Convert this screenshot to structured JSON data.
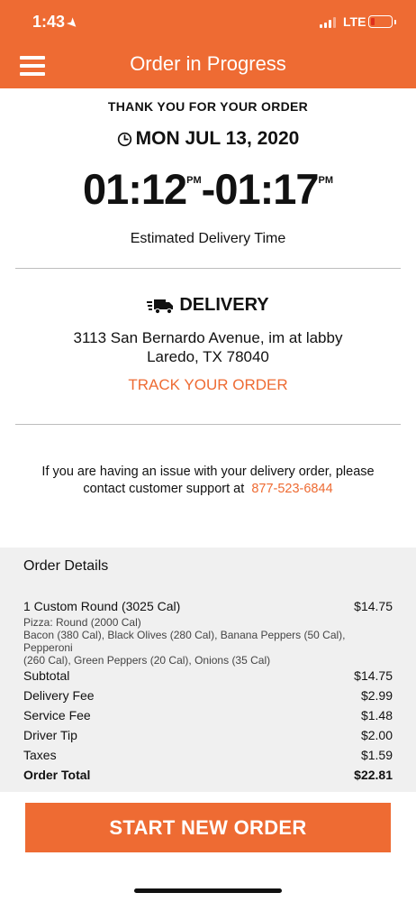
{
  "status_bar": {
    "time": "1:43",
    "network": "LTE"
  },
  "header": {
    "title": "Order in Progress",
    "menu_icon": "menu-icon"
  },
  "confirmation": {
    "thank_you": "THANK YOU FOR YOUR ORDER",
    "date": "MON JUL 13, 2020",
    "time_start": "01:12",
    "time_start_suffix": "PM",
    "time_sep": "-",
    "time_end": "01:17",
    "time_end_suffix": "PM",
    "estimate_label": "Estimated Delivery Time"
  },
  "delivery": {
    "label": "DELIVERY",
    "address_line1": "3113 San Bernardo Avenue, im at labby",
    "address_line2": "Laredo, TX 78040",
    "track_label": "TRACK YOUR ORDER"
  },
  "support": {
    "line1": "If you are having an issue with your delivery order, please",
    "line2": "contact customer support at",
    "phone": "877-523-6844"
  },
  "order_details": {
    "title": "Order Details",
    "item": {
      "name": "1 Custom Round (3025 Cal)",
      "price": "$14.75"
    },
    "item_desc_line1": "Pizza: Round (2000 Cal)",
    "item_desc_line2": "Bacon (380 Cal), Black Olives (280 Cal), Banana Peppers (50 Cal), Pepperoni",
    "item_desc_line3": "(260 Cal), Green Peppers (20 Cal), Onions (35 Cal)",
    "lines": [
      {
        "label": "Subtotal",
        "value": "$14.75"
      },
      {
        "label": "Delivery Fee",
        "value": "$2.99"
      },
      {
        "label": "Service Fee",
        "value": "$1.48"
      },
      {
        "label": "Driver Tip",
        "value": "$2.00"
      },
      {
        "label": "Taxes",
        "value": "$1.59"
      },
      {
        "label": "Order Total",
        "value": "$22.81"
      }
    ]
  },
  "cta": {
    "label": "START NEW ORDER"
  },
  "colors": {
    "brand_orange": "#ee6b33",
    "details_bg": "#f0f0f0"
  }
}
